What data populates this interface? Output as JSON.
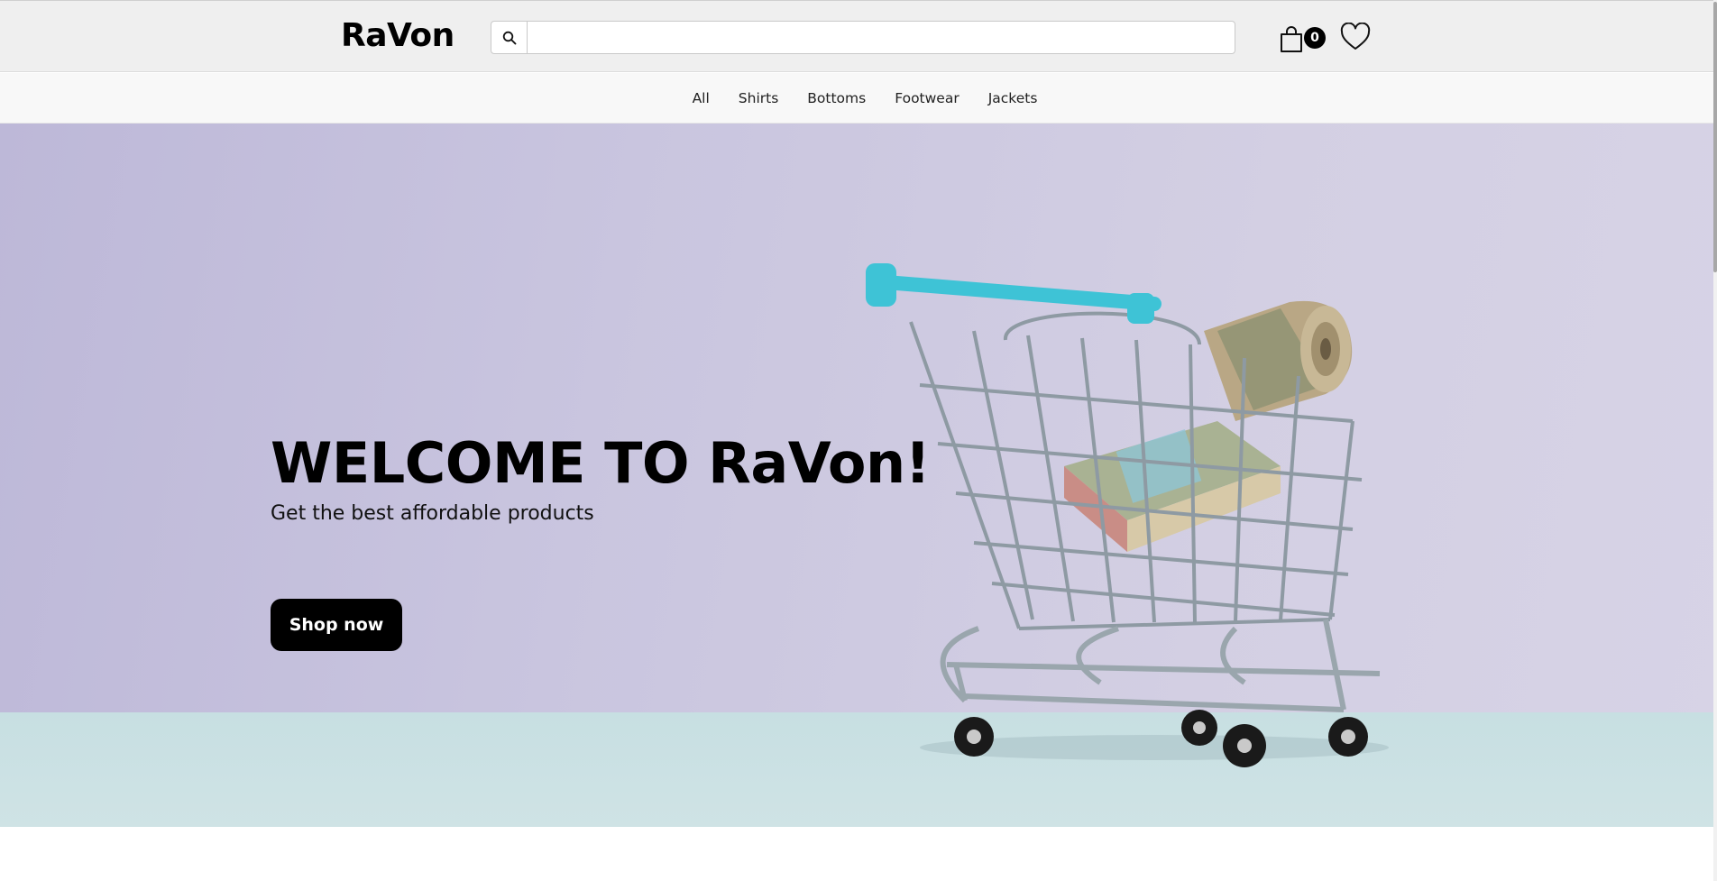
{
  "header": {
    "logo": "RaVon",
    "search": {
      "placeholder": "",
      "value": "",
      "icon": "search-icon"
    },
    "cart": {
      "icon": "shopping-bag-icon",
      "count": "0"
    },
    "wishlist": {
      "icon": "heart-icon"
    }
  },
  "nav": {
    "categories": [
      {
        "label": "All"
      },
      {
        "label": "Shirts"
      },
      {
        "label": "Bottoms"
      },
      {
        "label": "Footwear"
      },
      {
        "label": "Jackets"
      }
    ]
  },
  "hero": {
    "title": "WELCOME TO RaVon!",
    "subtitle": "Get the best affordable products",
    "cta_label": "Shop now",
    "image": "shopping-cart-with-money-photo"
  },
  "colors": {
    "header_bg": "#efefef",
    "nav_bg": "#f8f8f8",
    "hero_bg": "#cbc7df",
    "hero_floor": "#cbe1e3",
    "cta_bg": "#000000",
    "cart_handle": "#3ec3d6"
  }
}
